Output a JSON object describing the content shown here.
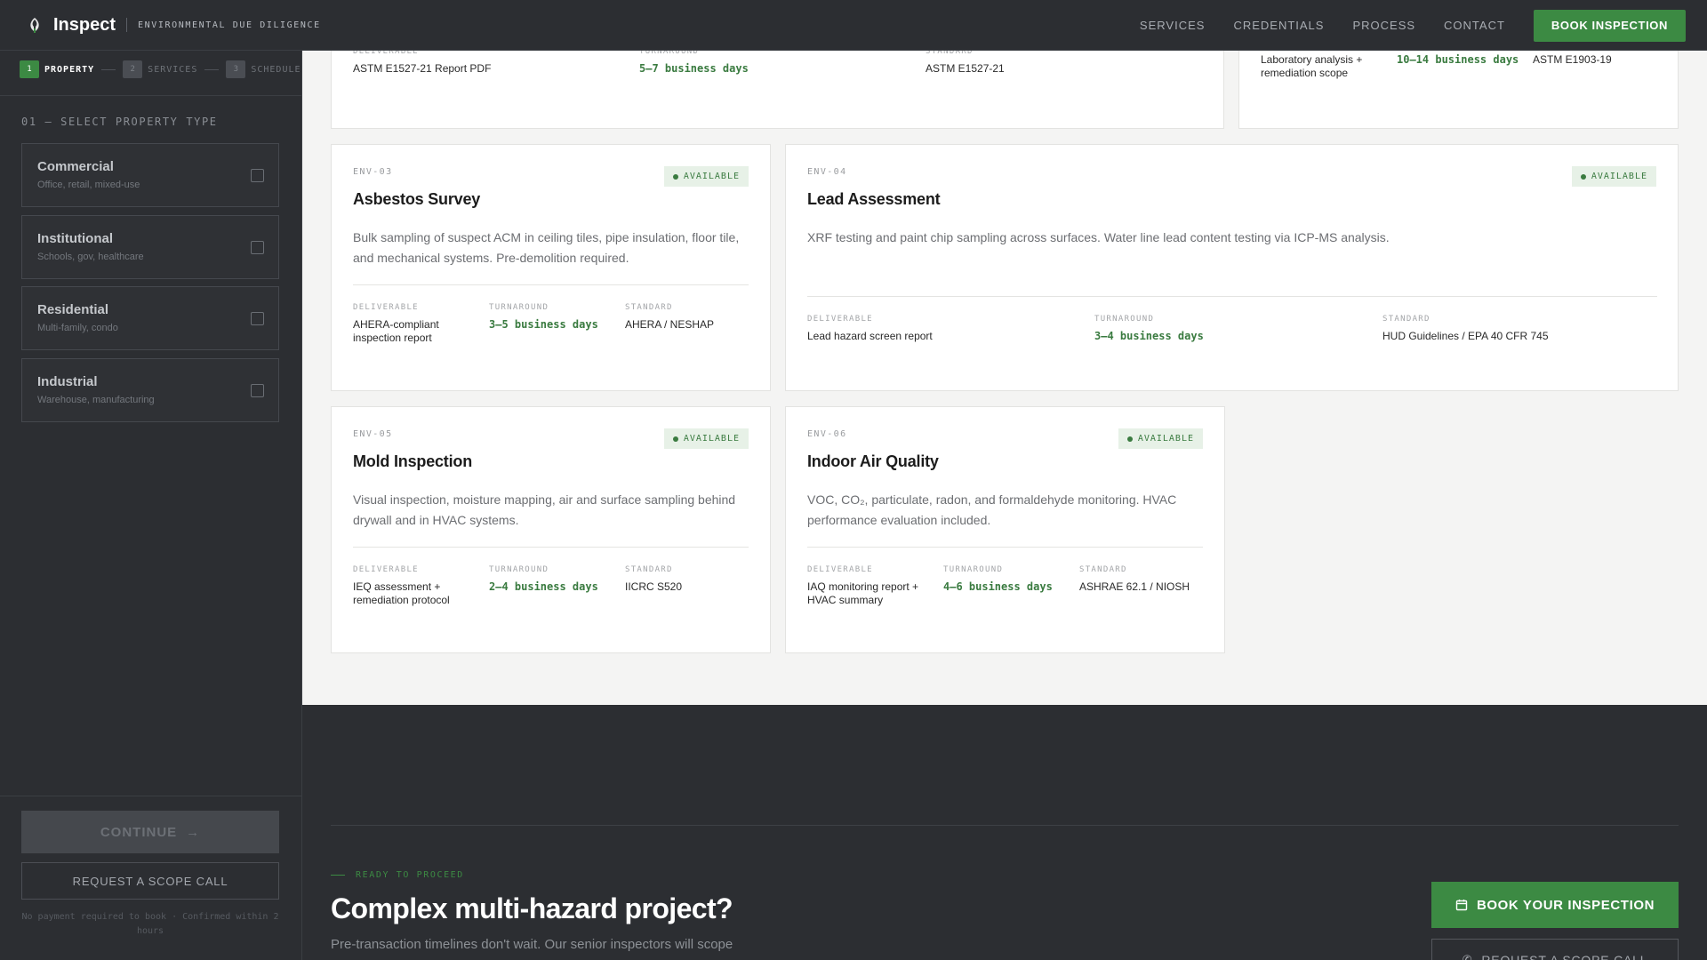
{
  "nav": {
    "brand": "Inspect",
    "tagline": "ENVIRONMENTAL DUE DILIGENCE",
    "links": [
      "SERVICES",
      "CREDENTIALS",
      "PROCESS",
      "CONTACT"
    ],
    "cta": "BOOK INSPECTION"
  },
  "sidebar": {
    "steps": [
      {
        "num": "1",
        "label": "PROPERTY"
      },
      {
        "num": "2",
        "label": "SERVICES"
      },
      {
        "num": "3",
        "label": "SCHEDULE"
      }
    ],
    "heading": "01 — SELECT PROPERTY TYPE",
    "options": [
      {
        "title": "Commercial",
        "sub": "Office, retail, mixed-use"
      },
      {
        "title": "Institutional",
        "sub": "Schools, gov, healthcare"
      },
      {
        "title": "Residential",
        "sub": "Multi-family, condo"
      },
      {
        "title": "Industrial",
        "sub": "Warehouse, manufacturing"
      }
    ],
    "continue": "CONTINUE",
    "scope_call": "REQUEST A SCOPE CALL",
    "note": "No payment required to book · Confirmed within 2 hours"
  },
  "labels": {
    "deliverable": "DELIVERABLE",
    "turnaround": "TURNAROUND",
    "standard": "STANDARD"
  },
  "cards": {
    "top1": {
      "deliverable": "ASTM E1527-21 Report PDF",
      "turnaround": "5–7 business days",
      "standard": "ASTM E1527-21"
    },
    "top2": {
      "deliverable": "Laboratory analysis + remediation scope",
      "turnaround": "10–14 business days",
      "standard": "ASTM E1903-19"
    },
    "env03": {
      "code": "ENV-03",
      "badge": "AVAILABLE",
      "title": "Asbestos Survey",
      "desc": "Bulk sampling of suspect ACM in ceiling tiles, pipe insulation, floor tile, and mechanical systems. Pre-demolition required.",
      "deliverable": "AHERA-compliant inspection report",
      "turnaround": "3–5 business days",
      "standard": "AHERA / NESHAP"
    },
    "env04": {
      "code": "ENV-04",
      "badge": "AVAILABLE",
      "title": "Lead Assessment",
      "desc": "XRF testing and paint chip sampling across surfaces. Water line lead content testing via ICP-MS analysis.",
      "deliverable": "Lead hazard screen report",
      "turnaround": "3–4 business days",
      "standard": "HUD Guidelines / EPA 40 CFR 745"
    },
    "env05": {
      "code": "ENV-05",
      "badge": "AVAILABLE",
      "title": "Mold Inspection",
      "desc": "Visual inspection, moisture mapping, air and surface sampling behind drywall and in HVAC systems.",
      "deliverable": "IEQ assessment + remediation protocol",
      "turnaround": "2–4 business days",
      "standard": "IICRC S520"
    },
    "env06": {
      "code": "ENV-06",
      "badge": "AVAILABLE",
      "title": "Indoor Air Quality",
      "desc": "VOC, CO₂, particulate, radon, and formaldehyde monitoring. HVAC performance evaluation included.",
      "deliverable": "IAQ monitoring report + HVAC summary",
      "turnaround": "4–6 business days",
      "standard": "ASHRAE 62.1 / NIOSH"
    }
  },
  "cta_section": {
    "kicker": "READY TO PROCEED",
    "title": "Complex multi-hazard project?",
    "subtitle": "Pre-transaction timelines don't wait. Our senior inspectors will scope",
    "book": "BOOK YOUR INSPECTION",
    "scope_call": "REQUEST A SCOPE CALL"
  },
  "colors": {
    "accent": "#3c8a43",
    "dark": "#2c2e32",
    "badge_bg": "#e7f1e7"
  }
}
